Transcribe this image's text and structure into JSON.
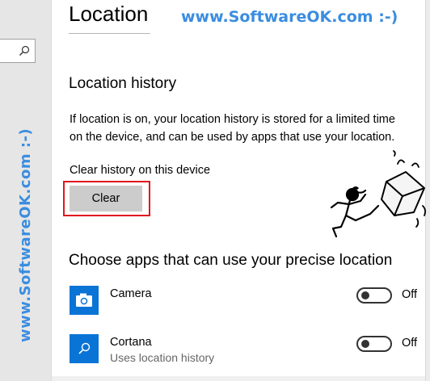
{
  "sidebar": {
    "search_icon": "search-icon",
    "watermark": "www.SoftwareOK.com :-)"
  },
  "header": {
    "title": "Location",
    "watermark": "www.SoftwareOK.com :-)"
  },
  "history": {
    "heading": "Location history",
    "description": "If location is on, your location history is stored for a limited time on the device, and can be used by apps that use your location.",
    "clear_label": "Clear history on this device",
    "clear_button": "Clear",
    "highlight_color": "#e0171f"
  },
  "apps": {
    "heading": "Choose apps that can use your precise location",
    "accent": "#0a74d6",
    "items": [
      {
        "name": "Camera",
        "subtitle": "",
        "icon": "camera-icon",
        "state": "Off"
      },
      {
        "name": "Cortana",
        "subtitle": "Uses location history",
        "icon": "search-icon",
        "state": "Off"
      }
    ]
  }
}
